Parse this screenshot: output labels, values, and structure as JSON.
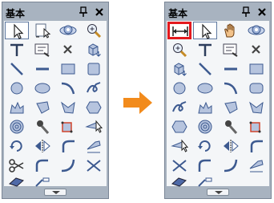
{
  "before": {
    "title": "基本",
    "tools": [
      "select-arrow-icon",
      "page-select-icon",
      "rotate-view-icon",
      "zoom-icon",
      "line-icon",
      "text-icon",
      "text-box-icon",
      "delete-cross-icon",
      "diagonal-line-icon",
      "rectangle-icon",
      "box-3d-icon",
      "circle-icon",
      "ellipse-icon",
      "arc-icon",
      "spiral-curve-icon",
      "polyline-icon",
      "polygon-icon",
      "crescent-icon",
      "hexagon-icon",
      "spiral-icon",
      "brush-icon",
      "rotate-shape-icon",
      "pointer-icon",
      "rotate-arrows-icon",
      "flip-icon",
      "fillet-icon",
      "pen-icon",
      "scissors-icon",
      "bezier-curve-icon",
      "corner-curve-icon",
      "cross-icon",
      "eraser-icon",
      "dimension-leader-icon"
    ]
  },
  "after": {
    "title": "基本",
    "tools": [
      "dimension-icon",
      "select-arrow-icon",
      "hand-pan-icon",
      "rotate-view-icon",
      "zoom-icon",
      "text-icon",
      "text-box-icon",
      "delete-cross-icon",
      "box-3d-icon",
      "diagonal-line-icon",
      "rectangle-icon",
      "circle-icon",
      "ellipse-icon",
      "arc-icon",
      "spiral-curve-icon",
      "crescent-icon",
      "polyline-icon",
      "polygon-icon",
      "hexagon-icon",
      "spiral-icon",
      "brush-icon",
      "rotate-shape-icon",
      "pointer-icon",
      "rotate-arrows-icon",
      "flip-icon",
      "fillet-icon",
      "pen-icon",
      "scissors-icon",
      "cross-icon",
      "bezier-curve-icon",
      "corner-curve-icon",
      "eraser-icon",
      "dimension-leader-icon"
    ],
    "highlighted_tool": "dimension-icon"
  },
  "colors": {
    "panel": "#a8b3c0",
    "highlight": "#e3191e",
    "arrow": "#f28b1c"
  }
}
